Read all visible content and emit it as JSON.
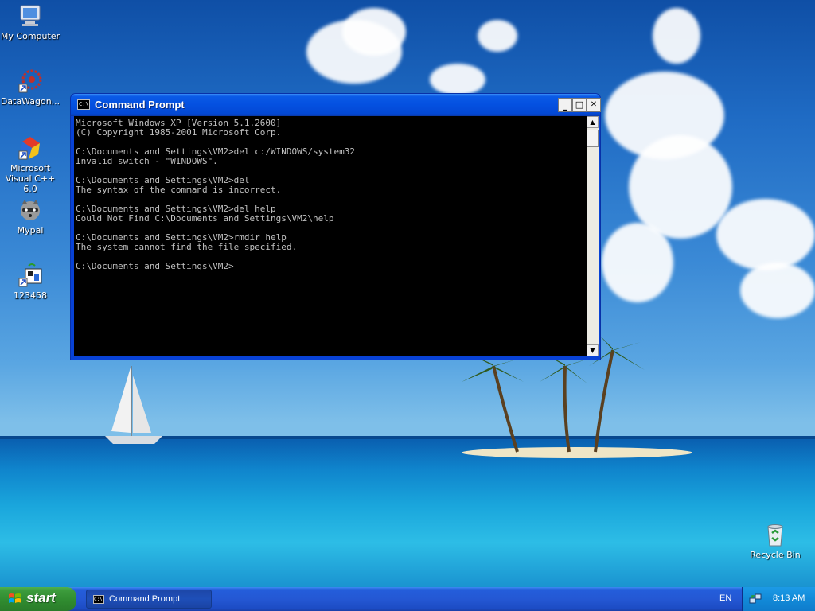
{
  "desktop": {
    "icons": [
      {
        "label": "My Computer",
        "icon": "my-computer-icon"
      },
      {
        "label": "DataWagon...",
        "icon": "datawagon-icon"
      },
      {
        "label": "Microsoft Visual C++ 6.0",
        "icon": "visual-cpp-icon"
      },
      {
        "label": "Mypal",
        "icon": "mypal-raccoon-icon"
      },
      {
        "label": "123458",
        "icon": "shortcut-app-icon"
      },
      {
        "label": "Recycle Bin",
        "icon": "recycle-bin-icon"
      }
    ]
  },
  "window": {
    "title": "Command Prompt",
    "minimize": "_",
    "maximize": "□",
    "close": "✕",
    "console_text": "Microsoft Windows XP [Version 5.1.2600]\n(C) Copyright 1985-2001 Microsoft Corp.\n\nC:\\Documents and Settings\\VM2>del c:/WINDOWS/system32\nInvalid switch - \"WINDOWS\".\n\nC:\\Documents and Settings\\VM2>del\nThe syntax of the command is incorrect.\n\nC:\\Documents and Settings\\VM2>del help\nCould Not Find C:\\Documents and Settings\\VM2\\help\n\nC:\\Documents and Settings\\VM2>rmdir help\nThe system cannot find the file specified.\n\nC:\\Documents and Settings\\VM2>"
  },
  "taskbar": {
    "start_label": "start",
    "task_label": "Command Prompt",
    "language": "EN",
    "clock": "8:13 AM"
  },
  "colors": {
    "titlebar": "#0450e0",
    "taskbar": "#245edb",
    "start_button": "#3c9b3c",
    "console_bg": "#000000",
    "console_text": "#c0c0c0"
  }
}
